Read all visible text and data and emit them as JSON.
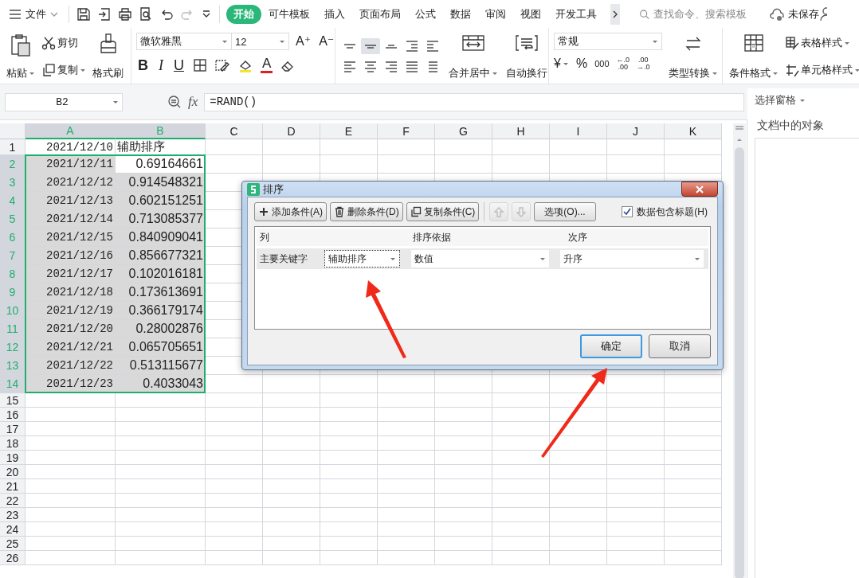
{
  "menu": {
    "label": "文件"
  },
  "ribbon_tabs": [
    {
      "label": "开始",
      "selected": true
    },
    {
      "label": "可牛模板",
      "selected": false
    },
    {
      "label": "插入",
      "selected": false
    },
    {
      "label": "页面布局",
      "selected": false
    },
    {
      "label": "公式",
      "selected": false
    },
    {
      "label": "数据",
      "selected": false
    },
    {
      "label": "审阅",
      "selected": false
    },
    {
      "label": "视图",
      "selected": false
    },
    {
      "label": "开发工具",
      "selected": false
    }
  ],
  "search": {
    "placeholder": "查找命令、搜索模板"
  },
  "save_status": "未保存",
  "ribbon": {
    "clipboard": {
      "paste": "粘贴",
      "cut": "剪切",
      "copy": "复制",
      "format_painter": "格式刷"
    },
    "font": {
      "name": "微软雅黑",
      "size": "12",
      "grow": "A⁺",
      "shrink": "A⁻",
      "bold": "B",
      "italic": "I",
      "underline": "U",
      "color_label": "A"
    },
    "alignment": {
      "buttons": [
        {
          "kind": "top",
          "selected": false
        },
        {
          "kind": "middle",
          "selected": true
        },
        {
          "kind": "bottom",
          "selected": false
        },
        {
          "kind": "outdent",
          "selected": false
        },
        {
          "kind": "indent",
          "selected": false
        },
        {
          "kind": "left",
          "selected": false
        },
        {
          "kind": "center",
          "selected": false
        },
        {
          "kind": "right",
          "selected": false
        },
        {
          "kind": "justify",
          "selected": false
        },
        {
          "kind": "distribute",
          "selected": false
        }
      ],
      "merge": "合并居中",
      "wrap": "自动换行"
    },
    "number": {
      "format": "常规",
      "currency": "¥",
      "percent": "%",
      "thousands": "000",
      "more_decimals": [
        "←.0",
        ".00"
      ],
      "fewer_decimals": [
        ".00",
        "→.0"
      ],
      "convert": "类型转换"
    },
    "styles": {
      "conditional": "条件格式",
      "table_style": "表格样式",
      "cell_style": "单元格样式"
    }
  },
  "name_box": "B2",
  "function_label": "fx",
  "formula": "=RAND()",
  "columns": [
    {
      "label": "A",
      "selected": true
    },
    {
      "label": "B",
      "selected": true
    },
    {
      "label": "C",
      "selected": false
    },
    {
      "label": "D",
      "selected": false
    },
    {
      "label": "E",
      "selected": false
    },
    {
      "label": "F",
      "selected": false
    },
    {
      "label": "G",
      "selected": false
    },
    {
      "label": "H",
      "selected": false
    },
    {
      "label": "I",
      "selected": false
    },
    {
      "label": "J",
      "selected": false
    },
    {
      "label": "K",
      "selected": false
    }
  ],
  "rows": [
    {
      "number": "1",
      "selected": false,
      "cells": [
        {
          "text": "2021/12/10",
          "kind": "date",
          "selected": false
        },
        {
          "text": "辅助排序",
          "kind": "text",
          "selected": false
        }
      ]
    },
    {
      "number": "2",
      "selected": true,
      "cells": [
        {
          "text": "2021/12/11",
          "kind": "date",
          "selected": true
        },
        {
          "text": "0.69164661",
          "kind": "number",
          "selected": false
        }
      ]
    },
    {
      "number": "3",
      "selected": true,
      "cells": [
        {
          "text": "2021/12/12",
          "kind": "date",
          "selected": true
        },
        {
          "text": "0.914548321",
          "kind": "number",
          "selected": true
        }
      ]
    },
    {
      "number": "4",
      "selected": true,
      "cells": [
        {
          "text": "2021/12/13",
          "kind": "date",
          "selected": true
        },
        {
          "text": "0.602151251",
          "kind": "number",
          "selected": true
        }
      ]
    },
    {
      "number": "5",
      "selected": true,
      "cells": [
        {
          "text": "2021/12/14",
          "kind": "date",
          "selected": true
        },
        {
          "text": "0.713085377",
          "kind": "number",
          "selected": true
        }
      ]
    },
    {
      "number": "6",
      "selected": true,
      "cells": [
        {
          "text": "2021/12/15",
          "kind": "date",
          "selected": true
        },
        {
          "text": "0.840909041",
          "kind": "number",
          "selected": true
        }
      ]
    },
    {
      "number": "7",
      "selected": true,
      "cells": [
        {
          "text": "2021/12/16",
          "kind": "date",
          "selected": true
        },
        {
          "text": "0.856677321",
          "kind": "number",
          "selected": true
        }
      ]
    },
    {
      "number": "8",
      "selected": true,
      "cells": [
        {
          "text": "2021/12/17",
          "kind": "date",
          "selected": true
        },
        {
          "text": "0.102016181",
          "kind": "number",
          "selected": true
        }
      ]
    },
    {
      "number": "9",
      "selected": true,
      "cells": [
        {
          "text": "2021/12/18",
          "kind": "date",
          "selected": true
        },
        {
          "text": "0.173613691",
          "kind": "number",
          "selected": true
        }
      ]
    },
    {
      "number": "10",
      "selected": true,
      "cells": [
        {
          "text": "2021/12/19",
          "kind": "date",
          "selected": true
        },
        {
          "text": "0.366179174",
          "kind": "number",
          "selected": true
        }
      ]
    },
    {
      "number": "11",
      "selected": true,
      "cells": [
        {
          "text": "2021/12/20",
          "kind": "date",
          "selected": true
        },
        {
          "text": "0.28002876",
          "kind": "number",
          "selected": true
        }
      ]
    },
    {
      "number": "12",
      "selected": true,
      "cells": [
        {
          "text": "2021/12/21",
          "kind": "date",
          "selected": true
        },
        {
          "text": "0.065705651",
          "kind": "number",
          "selected": true
        }
      ]
    },
    {
      "number": "13",
      "selected": true,
      "cells": [
        {
          "text": "2021/12/22",
          "kind": "date",
          "selected": true
        },
        {
          "text": "0.513115677",
          "kind": "number",
          "selected": true
        }
      ]
    },
    {
      "number": "14",
      "selected": true,
      "cells": [
        {
          "text": "2021/12/23",
          "kind": "date",
          "selected": true
        },
        {
          "text": "0.4033043",
          "kind": "number",
          "selected": true
        }
      ]
    },
    {
      "number": "15",
      "selected": false
    },
    {
      "number": "16",
      "selected": false
    },
    {
      "number": "17",
      "selected": false
    },
    {
      "number": "18",
      "selected": false
    },
    {
      "number": "19",
      "selected": false
    },
    {
      "number": "20",
      "selected": false
    },
    {
      "number": "21",
      "selected": false
    },
    {
      "number": "22",
      "selected": false
    },
    {
      "number": "23",
      "selected": false
    },
    {
      "number": "24",
      "selected": false
    },
    {
      "number": "25",
      "selected": false
    },
    {
      "number": "26",
      "selected": false
    }
  ],
  "side_panel": {
    "title": "选择窗格",
    "heading": "文档中的对象"
  },
  "dialog": {
    "title": "排序",
    "toolbar": [
      {
        "label": "添加条件(A)",
        "kind": "add"
      },
      {
        "label": "删除条件(D)",
        "kind": "delete"
      },
      {
        "label": "复制条件(C)",
        "kind": "copy"
      },
      {
        "kind": "up",
        "disabled": true
      },
      {
        "kind": "down",
        "disabled": true
      },
      {
        "label": "选项(O)...",
        "kind": "options"
      }
    ],
    "header_checkbox": {
      "label": "数据包含标题(H)",
      "checked": true
    },
    "columns": [
      "列",
      "排序依据",
      "次序"
    ],
    "conditions": [
      {
        "label": "主要关键字",
        "column": "辅助排序",
        "sort_on": "数值",
        "order": "升序"
      }
    ],
    "buttons": [
      {
        "label": "确定",
        "default": true
      },
      {
        "label": "取消",
        "default": false
      }
    ]
  }
}
